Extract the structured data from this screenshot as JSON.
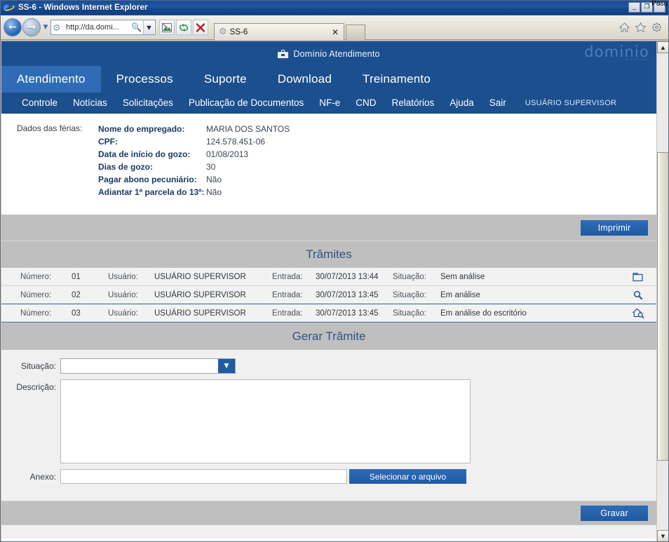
{
  "window": {
    "title": "SS-6 - Windows Internet Explorer",
    "minimize": "_",
    "maximize": "❐",
    "restore": "⌃",
    "search_tooltip": "Pesq"
  },
  "browser": {
    "back_arrow": "←",
    "forward_arrow": "→",
    "history_dropdown": "▼",
    "address_icon": "gear-icon",
    "address_value": "http://da.domi...",
    "address_value_prefix": "http://da.",
    "address_value_suffix": "domi...",
    "search_glyph": "🔍",
    "address_dropdown": "▼",
    "compat_view": "⬚",
    "refresh": "↻",
    "stop": "✕",
    "tab_label": "SS-6",
    "tab_close": "✕",
    "home_icon": "⌂",
    "favorites_icon": "☆",
    "tools_icon": "⚙"
  },
  "site": {
    "header_title": "Domínio Atendimento",
    "logo_word": "dominio",
    "logo_sub": "sistemas",
    "mainnav": [
      {
        "label": "Atendimento",
        "active": true
      },
      {
        "label": "Processos",
        "active": false
      },
      {
        "label": "Suporte",
        "active": false
      },
      {
        "label": "Download",
        "active": false
      },
      {
        "label": "Treinamento",
        "active": false
      }
    ],
    "subnav": [
      "Controle",
      "Notícias",
      "Solicitações",
      "Publicação de Documentos",
      "NF-e",
      "CND",
      "Relatórios",
      "Ajuda",
      "Sair"
    ],
    "user": "USUÁRIO SUPERVISOR"
  },
  "details": {
    "lead_label": "Dados das férias:",
    "fields": [
      {
        "key": "Nome do empregado:",
        "value": "MARIA DOS SANTOS"
      },
      {
        "key": "CPF:",
        "value": "124.578.451-06"
      },
      {
        "key": "Data de início do gozo:",
        "value": "01/08/2013"
      },
      {
        "key": "Dias de gozo:",
        "value": "30"
      },
      {
        "key": "Pagar abono pecuniário:",
        "value": "Não"
      },
      {
        "key": "Adiantar 1ª parcela do 13º:",
        "value": "Não"
      }
    ]
  },
  "actions": {
    "print_label": "Imprimir",
    "save_label": "Gravar",
    "select_file_label": "Selecionar o arquivo"
  },
  "tramites": {
    "title": "Trâmites",
    "labels": {
      "numero": "Número:",
      "usuario": "Usuário:",
      "entrada": "Entrada:",
      "situacao": "Situação:"
    },
    "rows": [
      {
        "numero": "01",
        "usuario": "USUÁRIO SUPERVISOR",
        "entrada": "30/07/2013 13:44",
        "situacao": "Sem análise",
        "icon": "folder-icon"
      },
      {
        "numero": "02",
        "usuario": "USUÁRIO SUPERVISOR",
        "entrada": "30/07/2013 13:45",
        "situacao": "Em análise",
        "icon": "magnifier-icon"
      },
      {
        "numero": "03",
        "usuario": "USUÁRIO SUPERVISOR",
        "entrada": "30/07/2013 13:45",
        "situacao": "Em análise do escritório",
        "icon": "house-search-icon"
      }
    ]
  },
  "gerar": {
    "title": "Gerar Trâmite",
    "situacao_label": "Situação:",
    "situacao_value": "",
    "descricao_label": "Descrição:",
    "descricao_value": "",
    "anexo_label": "Anexo:",
    "anexo_value": ""
  },
  "colors": {
    "brand_blue": "#1c4f8e",
    "accent_blue": "#2f6cb5",
    "gray_bar": "#bfbfbf",
    "row_bg": "#f2f2f2"
  }
}
